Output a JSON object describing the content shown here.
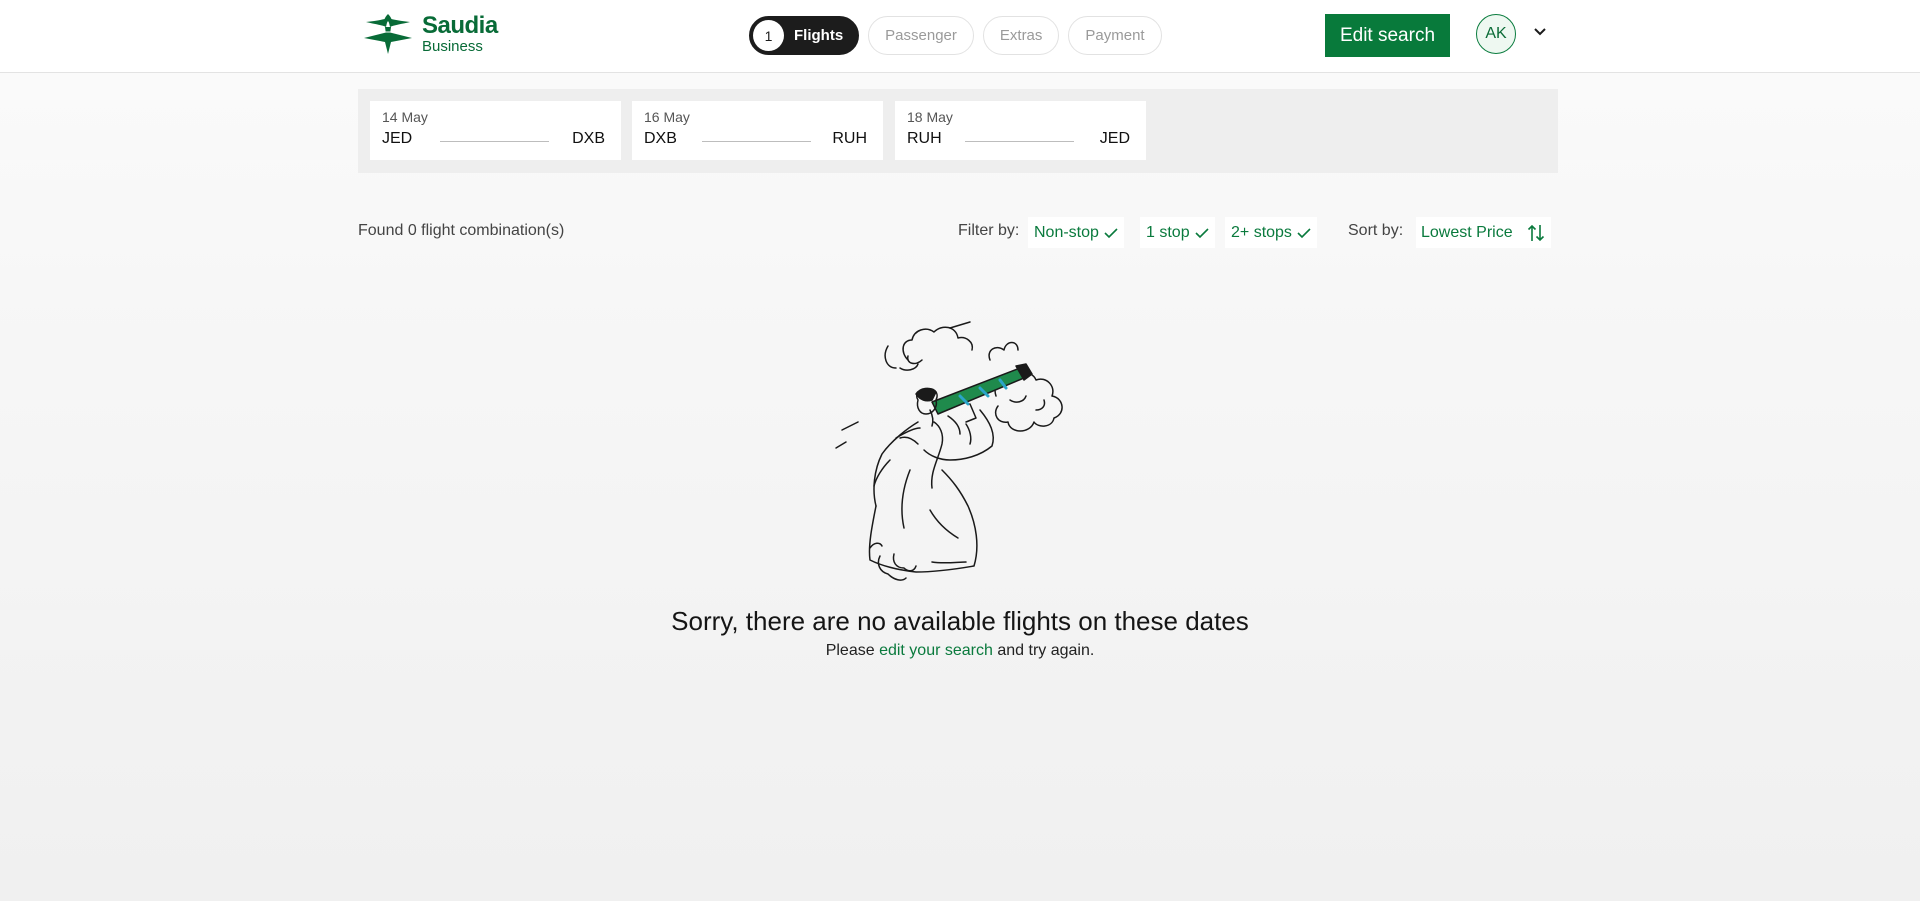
{
  "brand": {
    "name": "Saudia",
    "subtitle": "Business"
  },
  "steps": [
    {
      "number": "1",
      "label": "Flights",
      "active": true
    },
    {
      "label": "Passenger"
    },
    {
      "label": "Extras"
    },
    {
      "label": "Payment"
    }
  ],
  "header": {
    "edit_search_label": "Edit search",
    "avatar_initials": "AK"
  },
  "itinerary": [
    {
      "date": "14 May",
      "from": "JED",
      "to": "DXB"
    },
    {
      "date": "16 May",
      "from": "DXB",
      "to": "RUH"
    },
    {
      "date": "18 May",
      "from": "RUH",
      "to": "JED"
    }
  ],
  "results": {
    "found_text": "Found 0 flight combination(s)",
    "filter_label": "Filter by:",
    "filters": [
      "Non-stop",
      "1 stop",
      "2+ stops"
    ],
    "sort_label": "Sort by:",
    "sort_value": "Lowest Price"
  },
  "empty_state": {
    "title": "Sorry, there are no available flights on these dates",
    "prefix": "Please",
    "link": "edit your search",
    "suffix": "and try again."
  },
  "colors": {
    "brand_green": "#087a3b",
    "dark": "#1c1c1c",
    "panel": "#eeeeee"
  }
}
